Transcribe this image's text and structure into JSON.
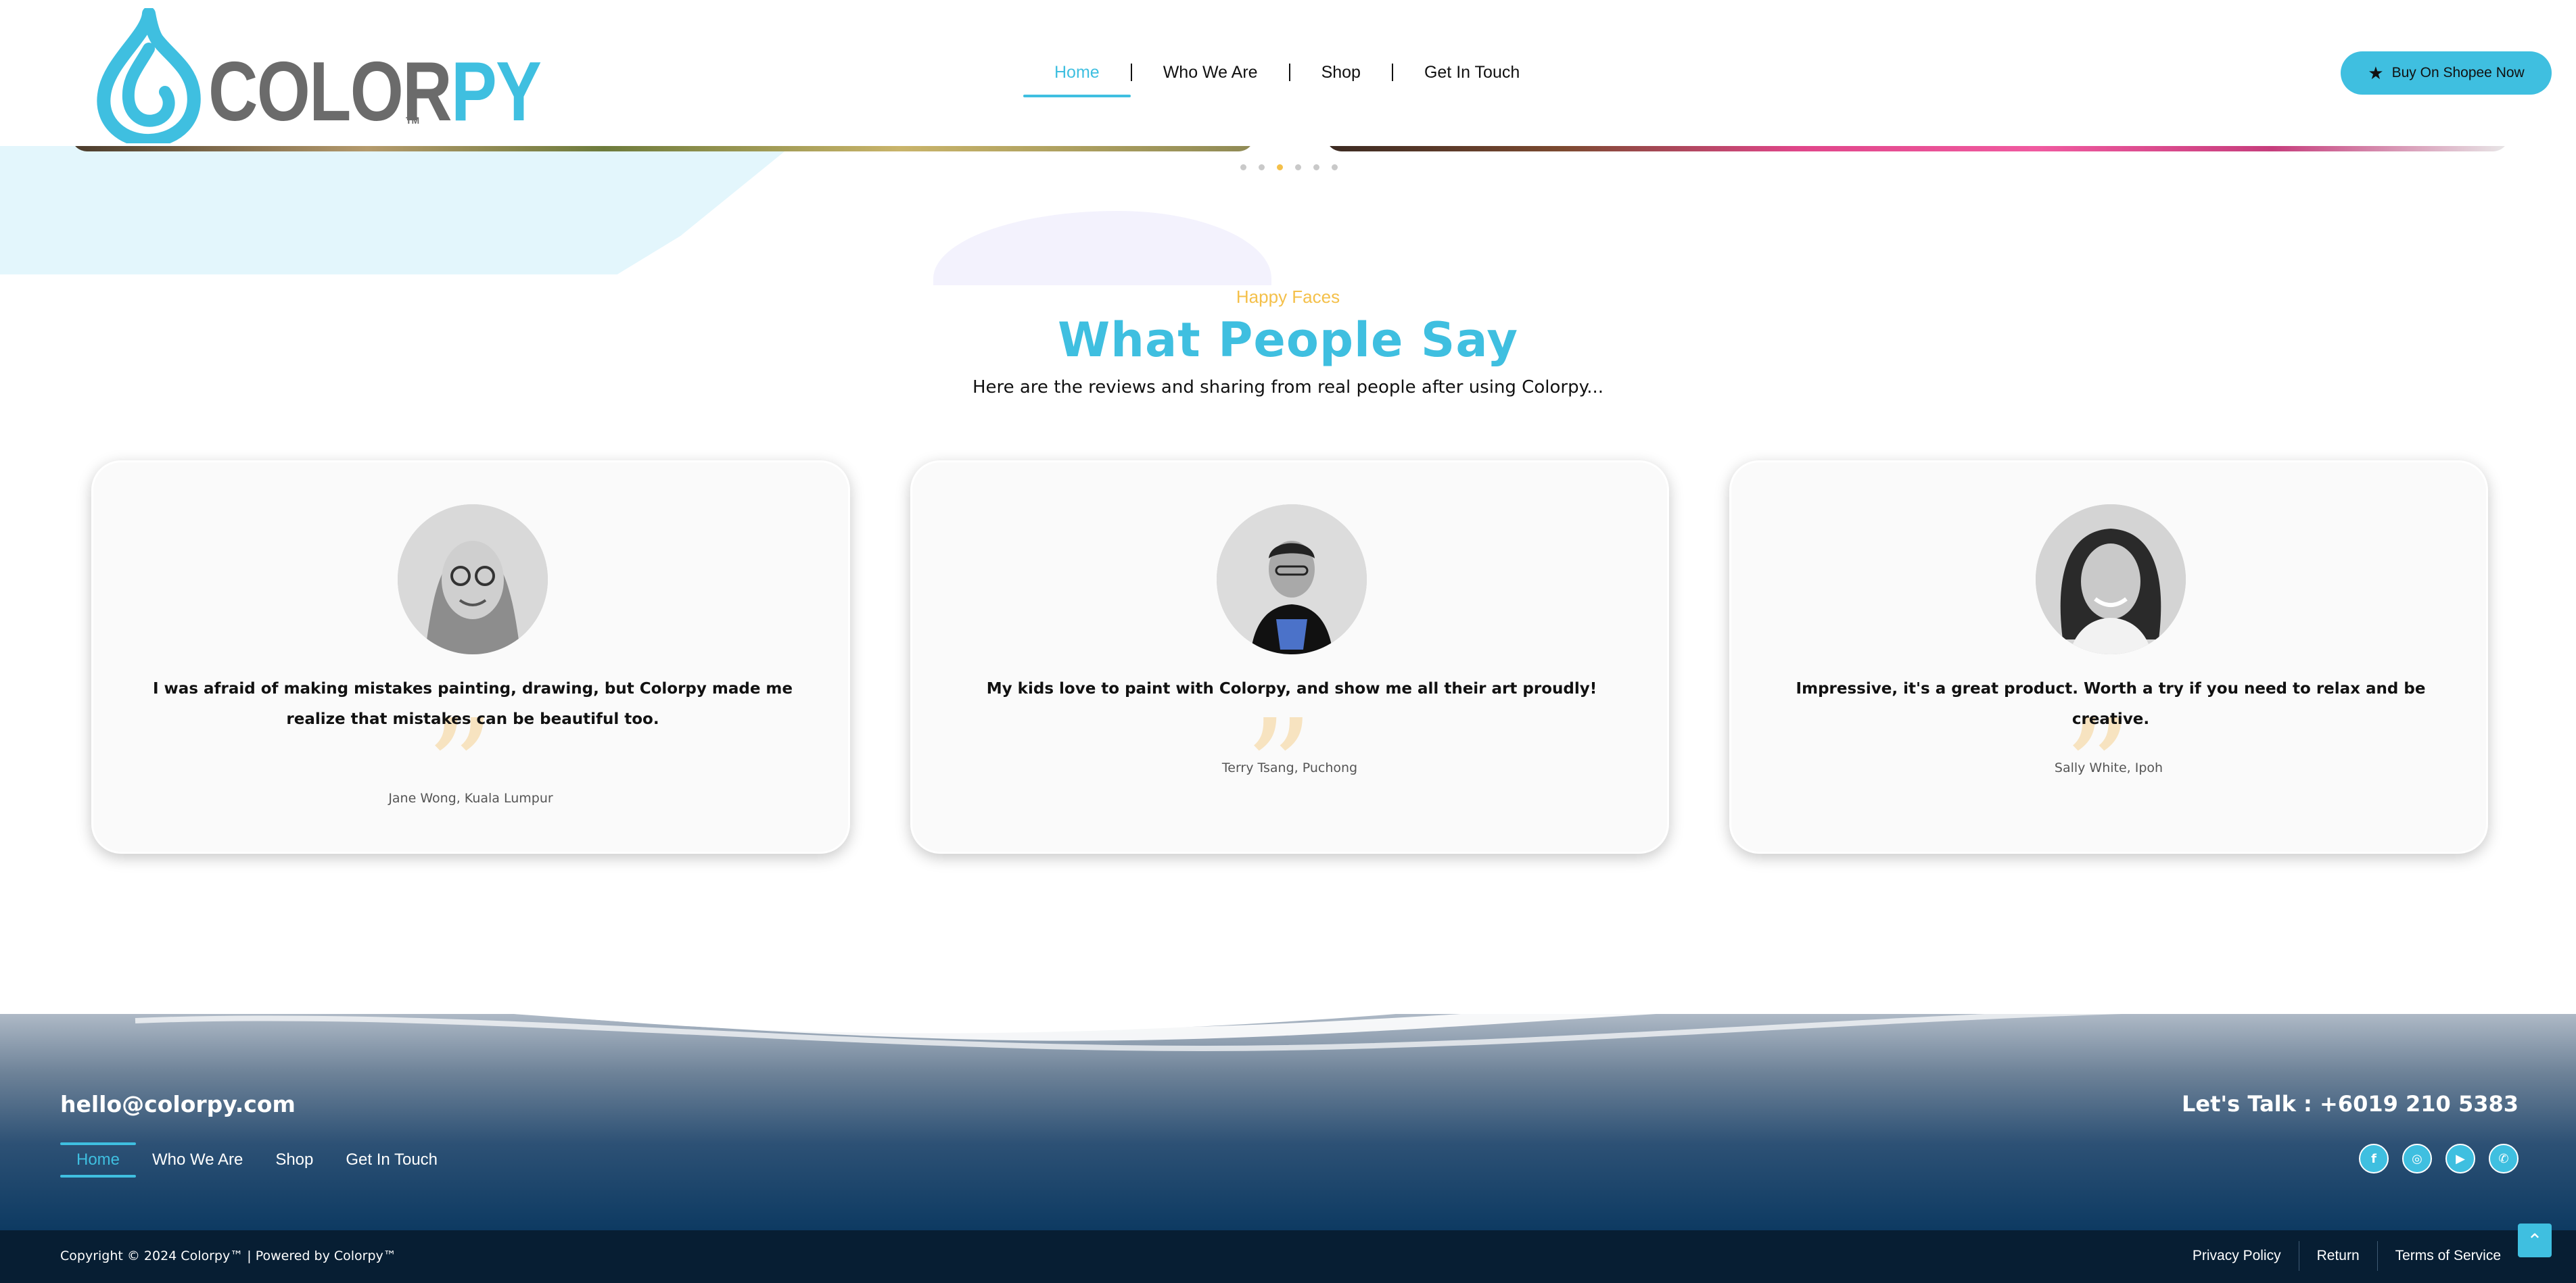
{
  "brand": {
    "name_part1": "COLOR",
    "name_part2": "PY",
    "tm": "TM",
    "color_grey": "#6b6b6b",
    "color_accent": "#3fbfe0"
  },
  "nav": {
    "items": [
      {
        "label": "Home",
        "active": true
      },
      {
        "label": "Who We Are",
        "active": false
      },
      {
        "label": "Shop",
        "active": false
      },
      {
        "label": "Get In Touch",
        "active": false
      }
    ]
  },
  "header_cta": {
    "label": "Buy On Shopee Now",
    "icon": "star-icon"
  },
  "slider": {
    "dot_count": 6,
    "active_dot": 3
  },
  "testimonials": {
    "eyebrow": "Happy Faces",
    "title": "What People Say",
    "subtitle": "Here are the reviews and sharing from real people after using Colorpy...",
    "items": [
      {
        "quote": "I was afraid of making mistakes painting, drawing, but Colorpy made me realize that mistakes can be beautiful too.",
        "author": "Jane Wong, Kuala Lumpur"
      },
      {
        "quote": "My kids love to paint with Colorpy, and show me all their art proudly!",
        "author": "Terry Tsang, Puchong"
      },
      {
        "quote": "Impressive, it's a great product. Worth a try if you need to relax and be creative.",
        "author": "Sally White, Ipoh"
      }
    ]
  },
  "footer": {
    "email": "hello@colorpy.com",
    "talk": "Let's Talk : +6019 210 5383",
    "nav": [
      {
        "label": "Home",
        "active": true
      },
      {
        "label": "Who We Are",
        "active": false
      },
      {
        "label": "Shop",
        "active": false
      },
      {
        "label": "Get In Touch",
        "active": false
      }
    ],
    "socials": [
      "facebook-icon",
      "instagram-icon",
      "youtube-icon",
      "whatsapp-icon"
    ],
    "copyright": "Copyright © 2024 Colorpy™ | Powered by Colorpy™",
    "legal": [
      "Privacy Policy",
      "Return",
      "Terms of Service"
    ]
  }
}
